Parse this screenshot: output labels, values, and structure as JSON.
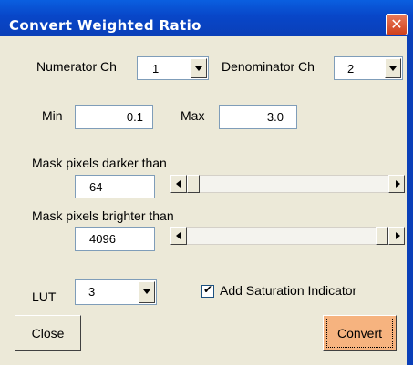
{
  "window": {
    "title": "Convert Weighted Ratio"
  },
  "channels": {
    "numerator_label": "Numerator Ch",
    "numerator_value": "1",
    "denominator_label": "Denominator Ch",
    "denominator_value": "2"
  },
  "range": {
    "min_label": "Min",
    "min_value": "0.1",
    "max_label": "Max",
    "max_value": "3.0"
  },
  "mask_dark": {
    "label": "Mask pixels darker than",
    "value": "64",
    "slider_level": 0.0
  },
  "mask_bright": {
    "label": "Mask pixels brighter than",
    "value": "4096",
    "slider_level": 1.0
  },
  "lut": {
    "label": "LUT",
    "value": "3"
  },
  "saturation": {
    "label": "Add Saturation Indicator",
    "checked": true
  },
  "buttons": {
    "close": "Close",
    "convert": "Convert"
  },
  "colors": {
    "title_bar": "#0a4fd8",
    "dialog_bg": "#ece9d8",
    "convert_bg": "#f6b37f",
    "close_x": "#d9552f"
  },
  "icons": {
    "close": "close-icon",
    "dropdown": "chevron-down-icon",
    "scroll_left": "arrow-left-icon",
    "scroll_right": "arrow-right-icon",
    "check": "checkmark-icon"
  }
}
